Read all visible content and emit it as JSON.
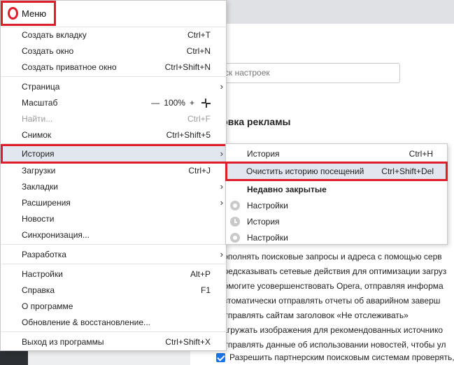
{
  "settings_page": {
    "search_placeholder": "ск настроек",
    "heading": "ировка рекламы",
    "options": [
      {
        "label": "Дополнять поисковые запросы и адреса с помощью серв",
        "checked": false
      },
      {
        "label": "Предсказывать сетевые действия для оптимизации загруз",
        "checked": false
      },
      {
        "label": "Помогите усовершенствовать Opera, отправляя информа",
        "checked": false
      },
      {
        "label": "Автоматически отправлять отчеты об аварийном заверш",
        "checked": false
      },
      {
        "label": "Отправлять сайтам заголовок «Не отслеживать»",
        "checked": false
      },
      {
        "label": "Загружать изображения для рекомендованных источнико",
        "checked": false
      },
      {
        "label": "Отправлять данные об использовании новостей, чтобы ул",
        "checked": false
      },
      {
        "label": "Разрешить партнерским поисковым системам проверять,",
        "checked": true
      }
    ]
  },
  "menu": {
    "title": "Меню",
    "items": {
      "new_tab": {
        "label": "Создать вкладку",
        "shortcut": "Ctrl+T"
      },
      "new_window": {
        "label": "Создать окно",
        "shortcut": "Ctrl+N"
      },
      "new_private": {
        "label": "Создать приватное окно",
        "shortcut": "Ctrl+Shift+N"
      },
      "page": {
        "label": "Страница"
      },
      "zoom": {
        "label": "Масштаб",
        "minus": "—",
        "value": "100%",
        "plus": "+"
      },
      "find": {
        "label": "Найти...",
        "shortcut": "Ctrl+F"
      },
      "snapshot": {
        "label": "Снимок",
        "shortcut": "Ctrl+Shift+5"
      },
      "history": {
        "label": "История"
      },
      "downloads": {
        "label": "Загрузки",
        "shortcut": "Ctrl+J"
      },
      "bookmarks": {
        "label": "Закладки"
      },
      "extensions": {
        "label": "Расширения"
      },
      "news": {
        "label": "Новости"
      },
      "sync": {
        "label": "Синхронизация..."
      },
      "developer": {
        "label": "Разработка"
      },
      "settings": {
        "label": "Настройки",
        "shortcut": "Alt+P"
      },
      "help": {
        "label": "Справка",
        "shortcut": "F1"
      },
      "about": {
        "label": "О программе"
      },
      "update": {
        "label": "Обновление & восстановление..."
      },
      "exit": {
        "label": "Выход из программы",
        "shortcut": "Ctrl+Shift+X"
      }
    },
    "arrow": "›"
  },
  "history_submenu": {
    "history": {
      "label": "История",
      "shortcut": "Ctrl+H"
    },
    "clear": {
      "label": "Очистить историю посещений",
      "shortcut": "Ctrl+Shift+Del"
    },
    "recent_title": "Недавно закрытые",
    "recent": [
      {
        "label": "Настройки",
        "icon": "gear-icon"
      },
      {
        "label": "История",
        "icon": "clock-icon"
      },
      {
        "label": "Настройки",
        "icon": "gear-icon"
      }
    ]
  },
  "colors": {
    "highlight_border": "#e01e2b",
    "highlight_bg": "#e2e6ef",
    "checkbox_on": "#1a73e8"
  }
}
